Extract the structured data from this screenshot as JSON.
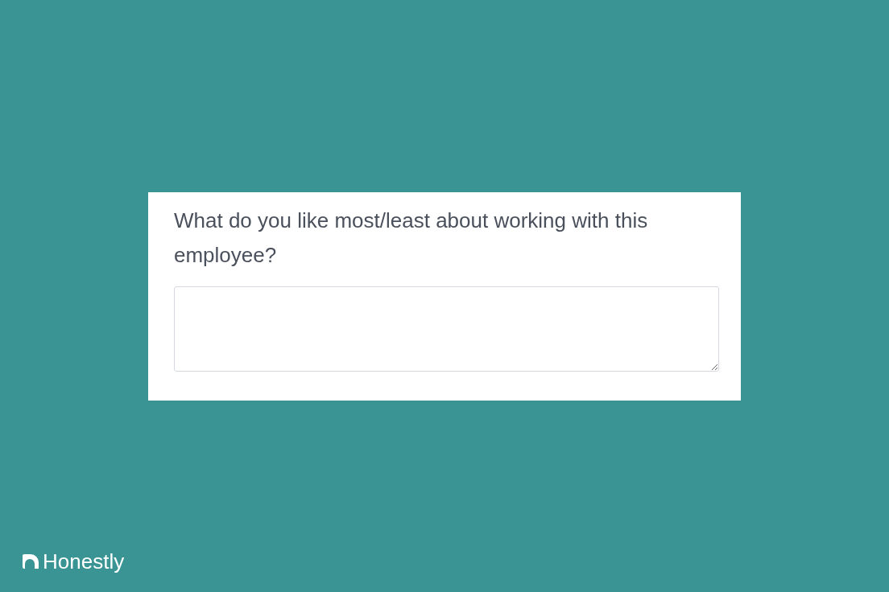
{
  "survey_card": {
    "question": "What do you like most/least about working with this employee?"
  },
  "brand": {
    "name": "Honestly"
  }
}
